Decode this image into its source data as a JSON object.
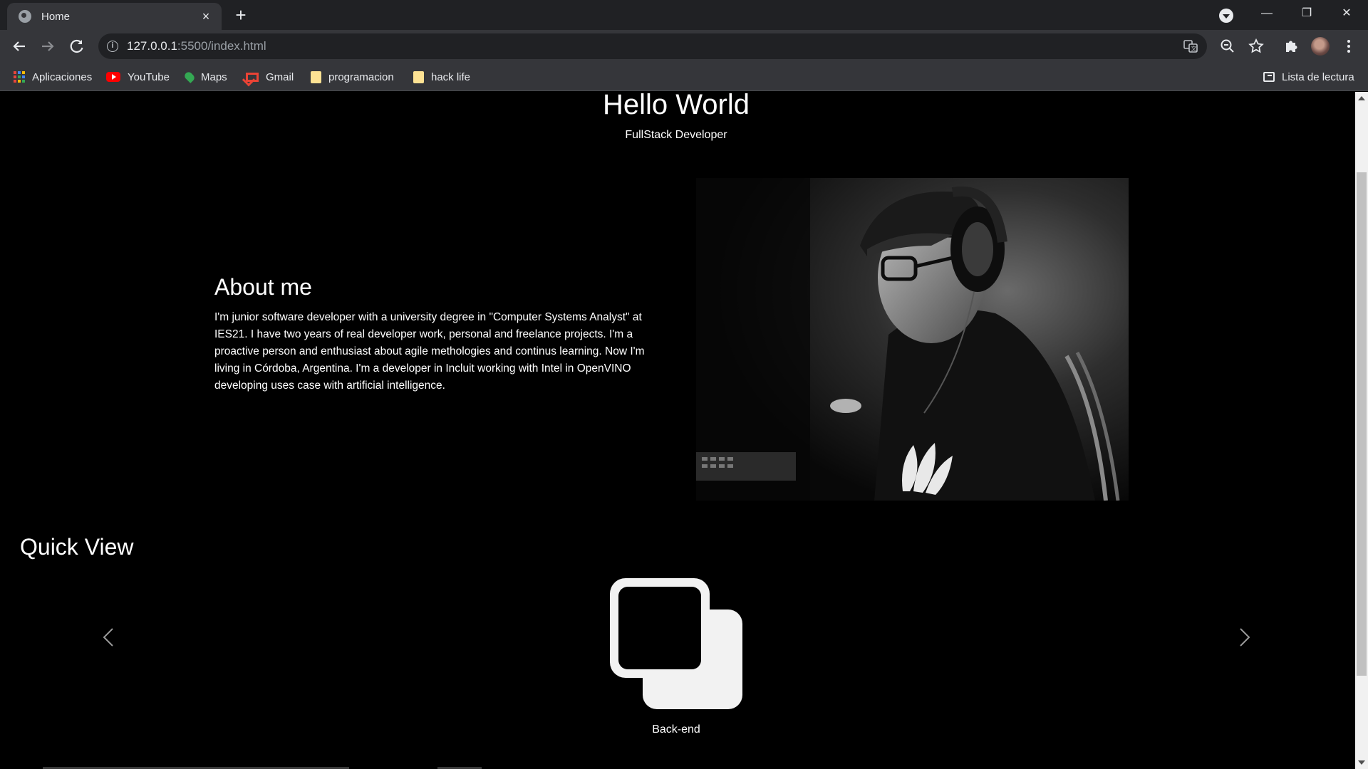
{
  "browser": {
    "tab_title": "Home",
    "tab_close": "×",
    "new_tab": "+",
    "url_host": "127.0.0.1",
    "url_rest": ":5500/index.html",
    "window_buttons": {
      "minimize": "—",
      "restore": "❐",
      "close": "✕"
    }
  },
  "bookmarks": [
    {
      "label": "Aplicaciones",
      "icon": "apps-icon"
    },
    {
      "label": "YouTube",
      "icon": "youtube-icon"
    },
    {
      "label": "Maps",
      "icon": "maps-icon"
    },
    {
      "label": "Gmail",
      "icon": "gmail-icon"
    },
    {
      "label": "programacion",
      "icon": "folder-icon"
    },
    {
      "label": "hack life",
      "icon": "folder-icon"
    }
  ],
  "reading_list": "Lista de lectura",
  "page": {
    "hero_title": "Hello World",
    "hero_subtitle": "FullStack Developer",
    "about_title": "About me",
    "about_text": "I'm junior software developer with a university degree in \"Computer Systems Analyst\" at IES21. I have two years of real developer work, personal and freelance projects. I'm a proactive person and enthusiast about agile methologies and continus learning. Now I'm living in Córdoba, Argentina. I'm a developer in Incluit working with Intel in OpenVINO developing uses case with artificial intelligence.",
    "quick_view_title": "Quick View",
    "carousel_label": "Back-end",
    "carousel_icon": "stacked-squares-icon"
  },
  "colors": {
    "page_bg": "#000000",
    "chrome_dark": "#202124",
    "chrome_tab": "#35363a",
    "text": "#ffffff"
  }
}
